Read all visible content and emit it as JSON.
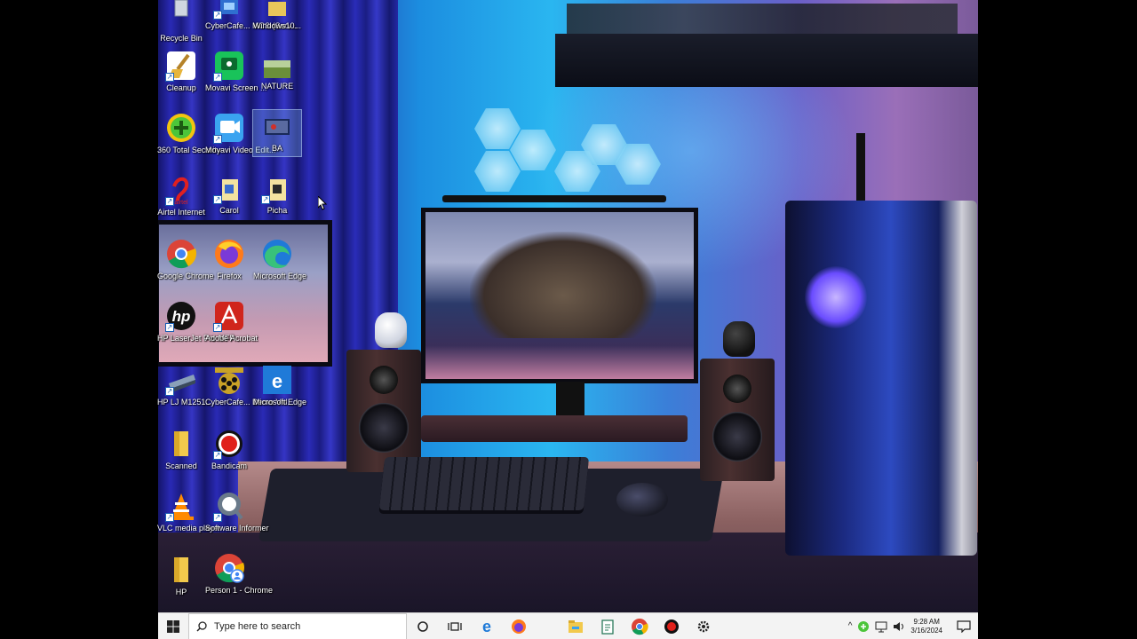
{
  "desktop": {
    "icons": [
      {
        "id": "recycle-bin",
        "label": "Recycle Bin",
        "icon": "recycle-bin-icon"
      },
      {
        "id": "cybercafe-mcs",
        "label": "CyberCafe... MCS (Serv...",
        "icon": "cybercafe-icon"
      },
      {
        "id": "windows10",
        "label": "Windows10...",
        "icon": "folder-icon"
      },
      {
        "id": "cleanup",
        "label": "Cleanup",
        "icon": "broom-icon"
      },
      {
        "id": "movavi-screen",
        "label": "Movavi Screen ...",
        "icon": "movavi-screen-icon"
      },
      {
        "id": "nature",
        "label": "NATURE",
        "icon": "image-folder-icon"
      },
      {
        "id": "360-total-security",
        "label": "360 Total Security",
        "icon": "shield-plus-icon"
      },
      {
        "id": "movavi-video-edit",
        "label": "Movavi Video Edit...",
        "icon": "movavi-video-icon"
      },
      {
        "id": "ba",
        "label": "BA",
        "icon": "video-file-icon"
      },
      {
        "id": "airtel-internet",
        "label": "Airtel Internet",
        "icon": "airtel-icon"
      },
      {
        "id": "carol",
        "label": "Carol",
        "icon": "document-icon"
      },
      {
        "id": "picha",
        "label": "Picha",
        "icon": "document-icon"
      },
      {
        "id": "google-chrome",
        "label": "Google Chrome",
        "icon": "chrome-icon"
      },
      {
        "id": "firefox",
        "label": "Firefox",
        "icon": "firefox-icon"
      },
      {
        "id": "microsoft-edge-1",
        "label": "Microsoft Edge",
        "icon": "edge-icon"
      },
      {
        "id": "hp-laserjet",
        "label": "HP LaserJet Pro MFP ...",
        "icon": "hp-icon"
      },
      {
        "id": "adobe-acrobat",
        "label": "Adobe Acrobat",
        "icon": "acrobat-icon"
      },
      {
        "id": "hp-lj",
        "label": "HP LJ M1251...",
        "icon": "scanner-icon"
      },
      {
        "id": "cybercafe-demo",
        "label": "CyberCafe... Demo Vid...",
        "icon": "film-reel-icon"
      },
      {
        "id": "microsoft-edge-2",
        "label": "Microsoft Edge",
        "icon": "edge-legacy-icon"
      },
      {
        "id": "scanned",
        "label": "Scanned",
        "icon": "folder-icon"
      },
      {
        "id": "bandicam",
        "label": "Bandicam",
        "icon": "record-icon"
      },
      {
        "id": "vlc",
        "label": "VLC media player",
        "icon": "vlc-cone-icon"
      },
      {
        "id": "software-informer",
        "label": "Software Informer",
        "icon": "magnifier-icon"
      },
      {
        "id": "hp-folder",
        "label": "HP",
        "icon": "folder-icon"
      },
      {
        "id": "person1-chrome",
        "label": "Person 1 - Chrome",
        "icon": "chrome-profile-icon"
      }
    ]
  },
  "taskbar": {
    "search_placeholder": "Type here to search",
    "pinned": [
      "cortana-icon",
      "task-view-icon",
      "edge-icon",
      "firefox-icon",
      "file-explorer-icon",
      "notepad-icon",
      "chrome-icon",
      "bandicam-icon",
      "settings-icon"
    ],
    "time": "9:28 AM",
    "date": "3/16/2024"
  },
  "colors": {
    "taskbar_bg": "#f3f3f3",
    "selection": "#78aae6"
  }
}
